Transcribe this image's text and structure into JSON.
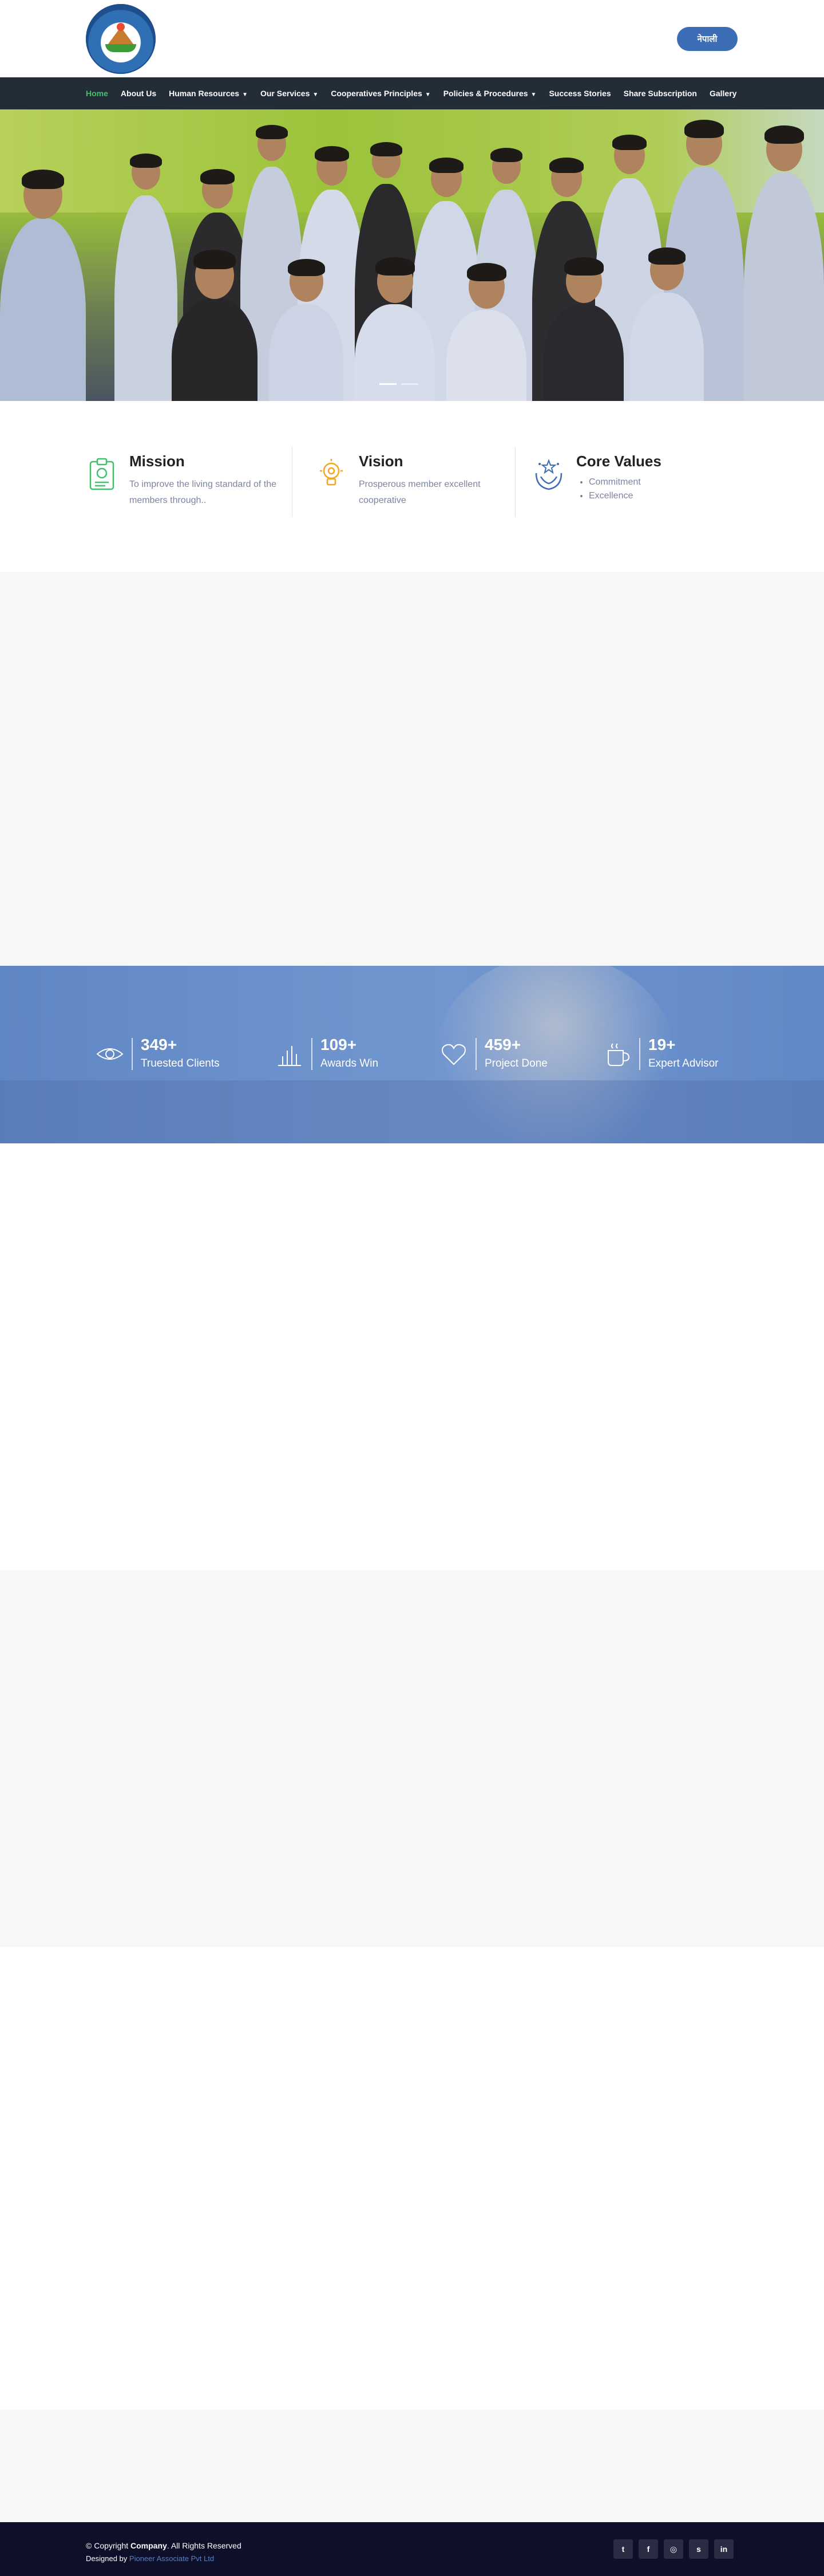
{
  "header": {
    "logo_alt": "Cooperative emblem",
    "language_button": "नेपाली"
  },
  "nav": {
    "items": [
      {
        "label": "Home",
        "dropdown": false
      },
      {
        "label": "About Us",
        "dropdown": false
      },
      {
        "label": "Human Resources",
        "dropdown": true
      },
      {
        "label": "Our Services",
        "dropdown": true
      },
      {
        "label": "Cooperatives Principles",
        "dropdown": true
      },
      {
        "label": "Policies & Procedures",
        "dropdown": true
      },
      {
        "label": "Success Stories",
        "dropdown": false
      },
      {
        "label": "Share Subscription",
        "dropdown": false
      },
      {
        "label": "Gallery",
        "dropdown": false
      }
    ],
    "active": "Home"
  },
  "hero": {
    "slides": 2,
    "active_slide": 1
  },
  "about": {
    "mission": {
      "title": "Mission",
      "text": "To improve the living standard of the members through..",
      "icon": "clipboard-icon",
      "color": "#3fc26b"
    },
    "vision": {
      "title": "Vision",
      "text": "Prosperous member excellent cooperative",
      "icon": "lightbulb-icon",
      "color": "#f5a623"
    },
    "values": {
      "title": "Core Values",
      "items": [
        "Commitment",
        "Excellence"
      ],
      "icon": "hands-star-icon",
      "color": "#3d6eb5"
    }
  },
  "stats": [
    {
      "number": "349+",
      "label": "Truested Clients",
      "icon": "eye-icon"
    },
    {
      "number": "109+",
      "label": "Awards Win",
      "icon": "bar-chart-icon"
    },
    {
      "number": "459+",
      "label": "Project Done",
      "icon": "heart-icon"
    },
    {
      "number": "19+",
      "label": "Expert Advisor",
      "icon": "coffee-cup-icon"
    }
  ],
  "footer": {
    "copyright_prefix": "© Copyright",
    "company": "Company",
    "copyright_suffix": ". All Rights Reserved",
    "designed_by": "Designed by",
    "designer": "Pioneer Associate Pvt Ltd",
    "social": [
      {
        "name": "twitter-icon",
        "glyph": "t"
      },
      {
        "name": "facebook-icon",
        "glyph": "f"
      },
      {
        "name": "instagram-icon",
        "glyph": "◎"
      },
      {
        "name": "skype-icon",
        "glyph": "s"
      },
      {
        "name": "linkedin-icon",
        "glyph": "in"
      }
    ]
  },
  "colors": {
    "nav_bg": "#232d38",
    "accent_green": "#3fc26b",
    "brand_blue": "#3d6eb5",
    "footer_bg": "#0e0f28"
  }
}
